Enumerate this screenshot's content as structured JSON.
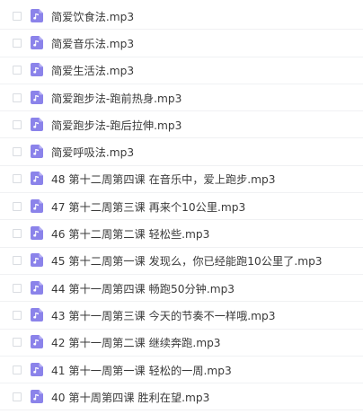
{
  "files": [
    {
      "name": "简爱饮食法.mp3",
      "icon": "music-file-icon"
    },
    {
      "name": "简爱音乐法.mp3",
      "icon": "music-file-icon"
    },
    {
      "name": "简爱生活法.mp3",
      "icon": "music-file-icon"
    },
    {
      "name": "简爱跑步法-跑前热身.mp3",
      "icon": "music-file-icon"
    },
    {
      "name": "简爱跑步法-跑后拉伸.mp3",
      "icon": "music-file-icon"
    },
    {
      "name": "简爱呼吸法.mp3",
      "icon": "music-file-icon"
    },
    {
      "name": "48 第十二周第四课 在音乐中，爱上跑步.mp3",
      "icon": "music-file-icon"
    },
    {
      "name": "47 第十二周第三课 再来个10公里.mp3",
      "icon": "music-file-icon"
    },
    {
      "name": "46 第十二周第二课 轻松些.mp3",
      "icon": "music-file-icon"
    },
    {
      "name": "45 第十二周第一课 发现么，你已经能跑10公里了.mp3",
      "icon": "music-file-icon"
    },
    {
      "name": "44 第十一周第四课 畅跑50分钟.mp3",
      "icon": "music-file-icon"
    },
    {
      "name": "43 第十一周第三课 今天的节奏不一样哦.mp3",
      "icon": "music-file-icon"
    },
    {
      "name": "42 第十一周第二课 继续奔跑.mp3",
      "icon": "music-file-icon"
    },
    {
      "name": "41 第十一周第一课 轻松的一周.mp3",
      "icon": "music-file-icon"
    },
    {
      "name": "40 第十周第四课 胜利在望.mp3",
      "icon": "music-file-icon"
    }
  ],
  "colors": {
    "icon": "#8b83ea",
    "text": "#3a3a3a",
    "divider": "#f0f1f3",
    "checkbox_border": "#d9dce1"
  }
}
